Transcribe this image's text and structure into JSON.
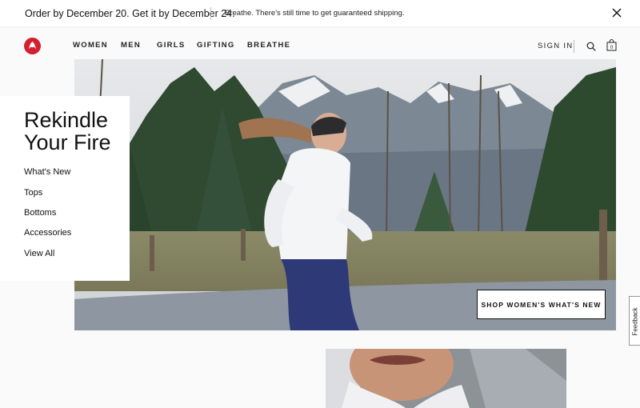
{
  "promo": {
    "main_text": "Order by December 20. Get it by December 24.",
    "sub_text": "Breathe. There's still time to get guaranteed shipping."
  },
  "icons": {
    "logo": "lululemon-logo-icon",
    "close": "close-icon",
    "search": "search-icon",
    "bag": "shopping-bag-icon"
  },
  "nav": {
    "items": [
      "WOMEN",
      "MEN",
      "GIRLS",
      "GIFTING",
      "BREATHE"
    ],
    "sign_in": "SIGN IN",
    "bag_count": "0"
  },
  "hero": {
    "title": "Rekindle\nYour Fire",
    "links": [
      "What's New",
      "Tops",
      "Bottoms",
      "Accessories",
      "View All"
    ],
    "cta": "SHOP WOMEN'S WHAT'S NEW"
  },
  "feedback": {
    "label": "Feedback"
  },
  "colors": {
    "brand_red": "#d22030",
    "background": "#fafafa"
  }
}
